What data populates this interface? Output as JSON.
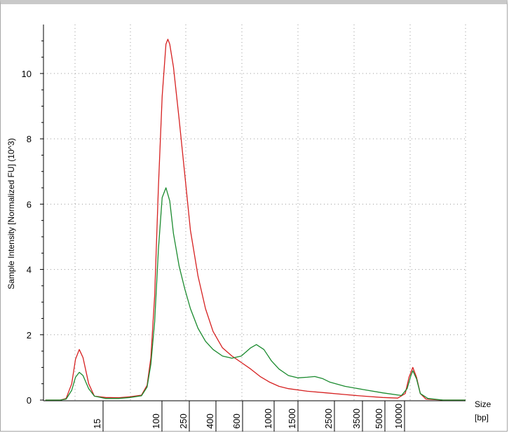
{
  "chart_data": {
    "type": "line",
    "title": "",
    "ylabel": "Sample Intensity [Normalized FU] (10^3)",
    "xlabel_line1": "Size",
    "xlabel_line2": "[bp]",
    "ylim": [
      0,
      11.5
    ],
    "y_ticks": [
      0,
      2,
      4,
      6,
      8,
      10
    ],
    "x_tick_labels": [
      "15",
      "100",
      "250",
      "400",
      "600",
      "1000",
      "1500",
      "2500",
      "3500",
      "5000",
      "10000"
    ],
    "grid": true,
    "legend": "none",
    "x_axis_note": "ladder sizes in bp (non-linear migration axis)",
    "series": [
      {
        "color": "#d62020",
        "points": [
          [
            1,
            0
          ],
          [
            9,
            0
          ],
          [
            12,
            0.05
          ],
          [
            15,
            0.5
          ],
          [
            17,
            1.25
          ],
          [
            19,
            1.55
          ],
          [
            21,
            1.3
          ],
          [
            24,
            0.5
          ],
          [
            27,
            0.12
          ],
          [
            33,
            0.08
          ],
          [
            40,
            0.07
          ],
          [
            46,
            0.1
          ],
          [
            52,
            0.15
          ],
          [
            55,
            0.45
          ],
          [
            57,
            1.3
          ],
          [
            59,
            3.2
          ],
          [
            61,
            6.5
          ],
          [
            63,
            9.3
          ],
          [
            65,
            10.9
          ],
          [
            66,
            11.05
          ],
          [
            67,
            10.9
          ],
          [
            69,
            10.2
          ],
          [
            72,
            8.6
          ],
          [
            75,
            6.9
          ],
          [
            78,
            5.2
          ],
          [
            82,
            3.8
          ],
          [
            86,
            2.8
          ],
          [
            90,
            2.1
          ],
          [
            95,
            1.6
          ],
          [
            100,
            1.35
          ],
          [
            105,
            1.15
          ],
          [
            110,
            0.95
          ],
          [
            115,
            0.72
          ],
          [
            120,
            0.55
          ],
          [
            125,
            0.42
          ],
          [
            130,
            0.35
          ],
          [
            140,
            0.27
          ],
          [
            150,
            0.22
          ],
          [
            160,
            0.17
          ],
          [
            170,
            0.12
          ],
          [
            180,
            0.08
          ],
          [
            188,
            0.06
          ],
          [
            192,
            0.2
          ],
          [
            194,
            0.7
          ],
          [
            196,
            1.0
          ],
          [
            198,
            0.7
          ],
          [
            200,
            0.2
          ],
          [
            203,
            0.03
          ],
          [
            212,
            0
          ],
          [
            224,
            0
          ]
        ]
      },
      {
        "color": "#1a8a2e",
        "points": [
          [
            1,
            0
          ],
          [
            9,
            0
          ],
          [
            12,
            0.03
          ],
          [
            15,
            0.3
          ],
          [
            17,
            0.7
          ],
          [
            19,
            0.85
          ],
          [
            21,
            0.75
          ],
          [
            24,
            0.35
          ],
          [
            27,
            0.12
          ],
          [
            33,
            0.05
          ],
          [
            40,
            0.05
          ],
          [
            46,
            0.08
          ],
          [
            52,
            0.13
          ],
          [
            55,
            0.4
          ],
          [
            57,
            1.1
          ],
          [
            59,
            2.4
          ],
          [
            61,
            4.6
          ],
          [
            63,
            6.2
          ],
          [
            65,
            6.5
          ],
          [
            67,
            6.1
          ],
          [
            69,
            5.1
          ],
          [
            72,
            4.1
          ],
          [
            75,
            3.4
          ],
          [
            78,
            2.8
          ],
          [
            82,
            2.2
          ],
          [
            86,
            1.8
          ],
          [
            90,
            1.55
          ],
          [
            95,
            1.35
          ],
          [
            100,
            1.28
          ],
          [
            105,
            1.35
          ],
          [
            110,
            1.6
          ],
          [
            113,
            1.7
          ],
          [
            117,
            1.55
          ],
          [
            121,
            1.2
          ],
          [
            125,
            0.95
          ],
          [
            130,
            0.75
          ],
          [
            135,
            0.68
          ],
          [
            140,
            0.7
          ],
          [
            144,
            0.72
          ],
          [
            148,
            0.66
          ],
          [
            152,
            0.55
          ],
          [
            160,
            0.42
          ],
          [
            170,
            0.32
          ],
          [
            180,
            0.22
          ],
          [
            190,
            0.14
          ],
          [
            193,
            0.35
          ],
          [
            195,
            0.75
          ],
          [
            196,
            0.9
          ],
          [
            198,
            0.65
          ],
          [
            200,
            0.2
          ],
          [
            204,
            0.05
          ],
          [
            212,
            0
          ],
          [
            224,
            0
          ]
        ]
      }
    ]
  }
}
